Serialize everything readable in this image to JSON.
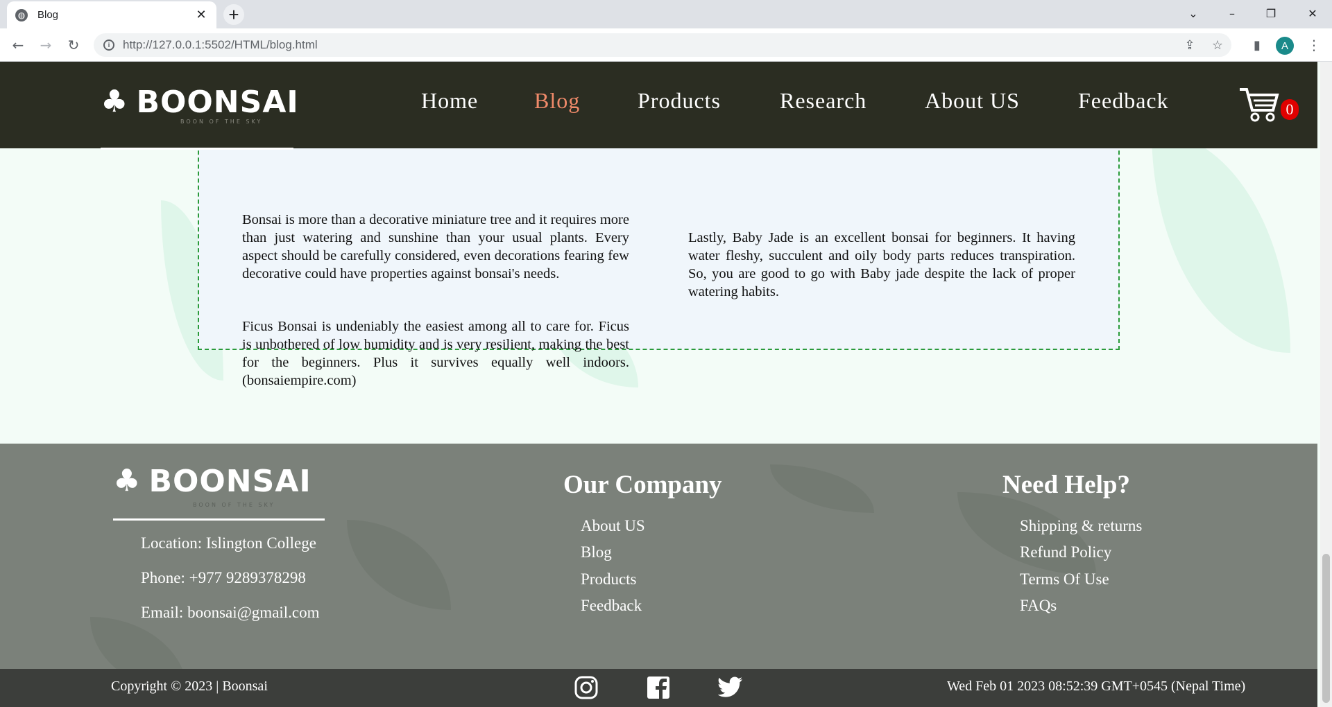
{
  "browser": {
    "tab_title": "Blog",
    "tab_close": "✕",
    "new_tab": "+",
    "url": "http://127.0.0.1:5502/HTML/blog.html",
    "profile_initial": "A"
  },
  "site": {
    "logo_text": "BOONSAI",
    "logo_tagline": "BOON OF THE SKY",
    "nav": [
      {
        "label": "Home"
      },
      {
        "label": "Blog"
      },
      {
        "label": "Products"
      },
      {
        "label": "Research"
      },
      {
        "label": "About US"
      },
      {
        "label": "Feedback"
      }
    ],
    "active_nav": "Blog",
    "cart_count": "0",
    "accent_color": "#f08a6a"
  },
  "article": {
    "left_paragraphs": [
      "Bonsai is more than a decorative miniature tree and it requires more than just watering and sunshine than your usual plants. Every aspect should be carefully considered, even decorations fearing few decorative could have properties against bonsai's needs.",
      "Ficus Bonsai is undeniably the easiest among all to care for. Ficus is unbothered of low humidity and is very resilient, making the best for the beginners. Plus it survives equally well indoors. (bonsaiempire.com)"
    ],
    "right_paragraphs": [
      "Lastly, Baby Jade is an excellent bonsai for beginners. It having water fleshy, succulent and oily body parts reduces transpiration. So, you are good to go with Baby jade despite the lack of proper watering habits."
    ]
  },
  "footer": {
    "contact": {
      "location": "Location: Islington College",
      "phone": "Phone: +977 9289378298",
      "email": "Email: boonsai@gmail.com"
    },
    "company_title": "Our Company",
    "company_links": [
      "About US",
      "Blog",
      "Products",
      "Feedback"
    ],
    "help_title": "Need Help?",
    "help_links": [
      "Shipping & returns",
      "Refund Policy",
      "Terms Of Use",
      "FAQs"
    ],
    "copyright": "Copyright © 2023 | Boonsai",
    "datetime": "Wed Feb 01 2023 08:52:39 GMT+0545 (Nepal Time)",
    "social_icons": [
      "instagram-icon",
      "facebook-icon",
      "twitter-icon"
    ]
  }
}
